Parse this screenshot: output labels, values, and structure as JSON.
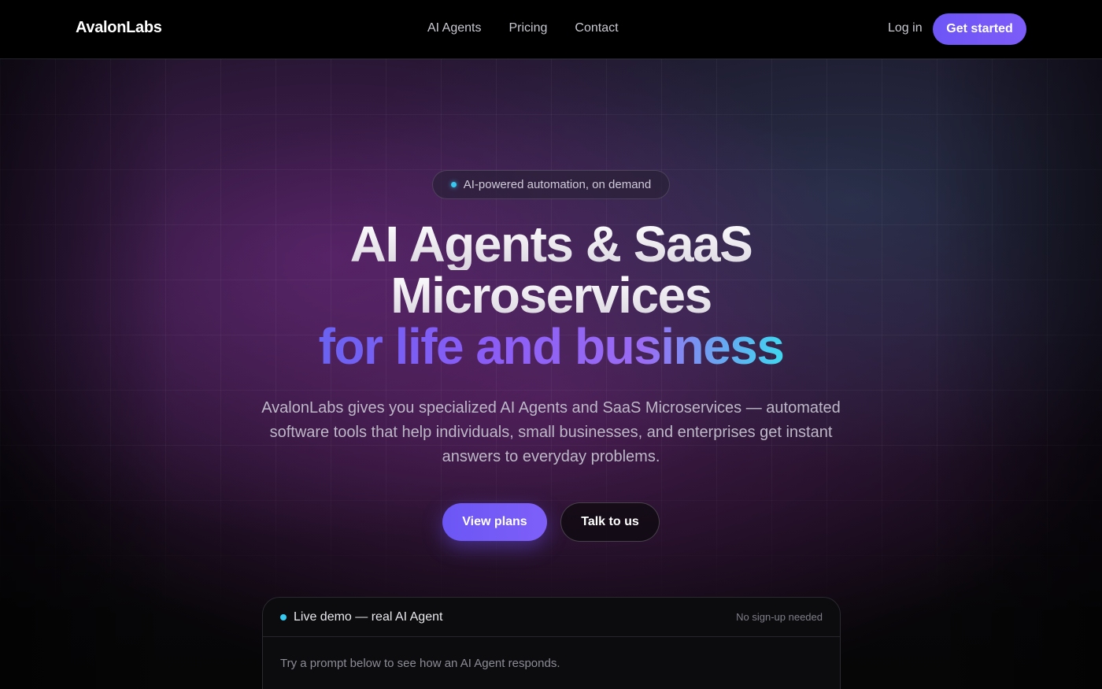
{
  "nav": {
    "logo": "AvalonLabs",
    "links": [
      "AI Agents",
      "Pricing",
      "Contact"
    ],
    "login": "Log in",
    "cta": "Get started"
  },
  "hero": {
    "badge": "AI-powered automation, on demand",
    "headline_line1": "AI Agents & SaaS",
    "headline_line2": "Microservices",
    "headline_line3": "for life and business",
    "subtitle": "AvalonLabs gives you specialized AI Agents and SaaS Microservices — automated software tools that help individuals, small businesses, and enterprises get instant answers to everyday problems.",
    "primary_button": "View plans",
    "secondary_button": "Talk to us"
  },
  "demo": {
    "title": "Live demo — real AI Agent",
    "note": "No sign-up needed",
    "prompt_hint": "Try a prompt below to see how an AI Agent responds."
  },
  "colors": {
    "accent": "#6d55f6",
    "status_dot": "#38c9f0",
    "gradient_start": "#6a62f2",
    "gradient_end": "#3fd6ef"
  }
}
